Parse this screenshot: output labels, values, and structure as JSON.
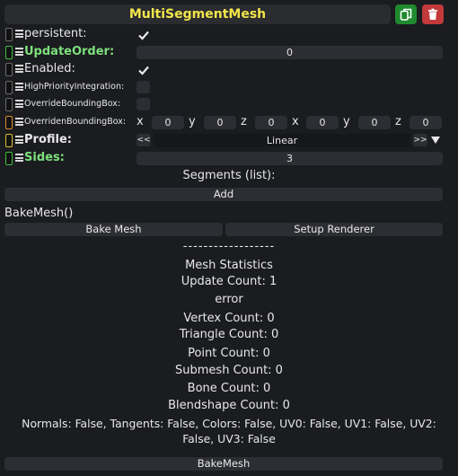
{
  "header": {
    "title": "MultiSegmentMesh",
    "duplicate_icon": "copy-icon",
    "delete_icon": "trash-icon",
    "colors": {
      "title": "#f2e64a",
      "duplicate": "#1f8a2e",
      "delete": "#c23a3a"
    }
  },
  "fields": {
    "persistent": {
      "label": "persistent:",
      "checked": true
    },
    "update_order": {
      "label": "UpdateOrder:",
      "value": "0"
    },
    "enabled": {
      "label": "Enabled:",
      "checked": true
    },
    "high_priority": {
      "label": "HighPriorityIntegration:",
      "checked": false
    },
    "override_bbox": {
      "label": "OverrideBoundingBox:",
      "checked": false
    },
    "overriden_bbox": {
      "label": "OverridenBoundingBox:",
      "axes": [
        "x",
        "y",
        "z",
        "x",
        "y",
        "z"
      ],
      "values": [
        "0",
        "0",
        "0",
        "0",
        "0",
        "0"
      ]
    },
    "profile": {
      "label": "Profile:",
      "prev": "<<",
      "value": "Linear",
      "next": ">>"
    },
    "sides": {
      "label": "Sides:",
      "value": "3"
    }
  },
  "segments": {
    "title": "Segments (list):",
    "add_label": "Add"
  },
  "bake": {
    "title": "BakeMesh()",
    "bake_button": "Bake Mesh",
    "setup_button": "Setup Renderer"
  },
  "stats": {
    "separator": "------------------",
    "heading": "Mesh Statistics",
    "update_count": "Update Count: 1",
    "error": "error",
    "vertex_count": "Vertex Count: 0",
    "triangle_count": "Triangle Count: 0",
    "point_count": "Point Count: 0",
    "submesh_count": "Submesh Count: 0",
    "bone_count": "Bone Count: 0",
    "blendshape_count": "Blendshape Count: 0",
    "attributes_line1": "Normals: False, Tangents: False, Colors: False, UV0: False, UV1: False, UV2:",
    "attributes_line2": "False, UV3: False"
  },
  "footer": {
    "bake_mesh_button": "BakeMesh"
  }
}
